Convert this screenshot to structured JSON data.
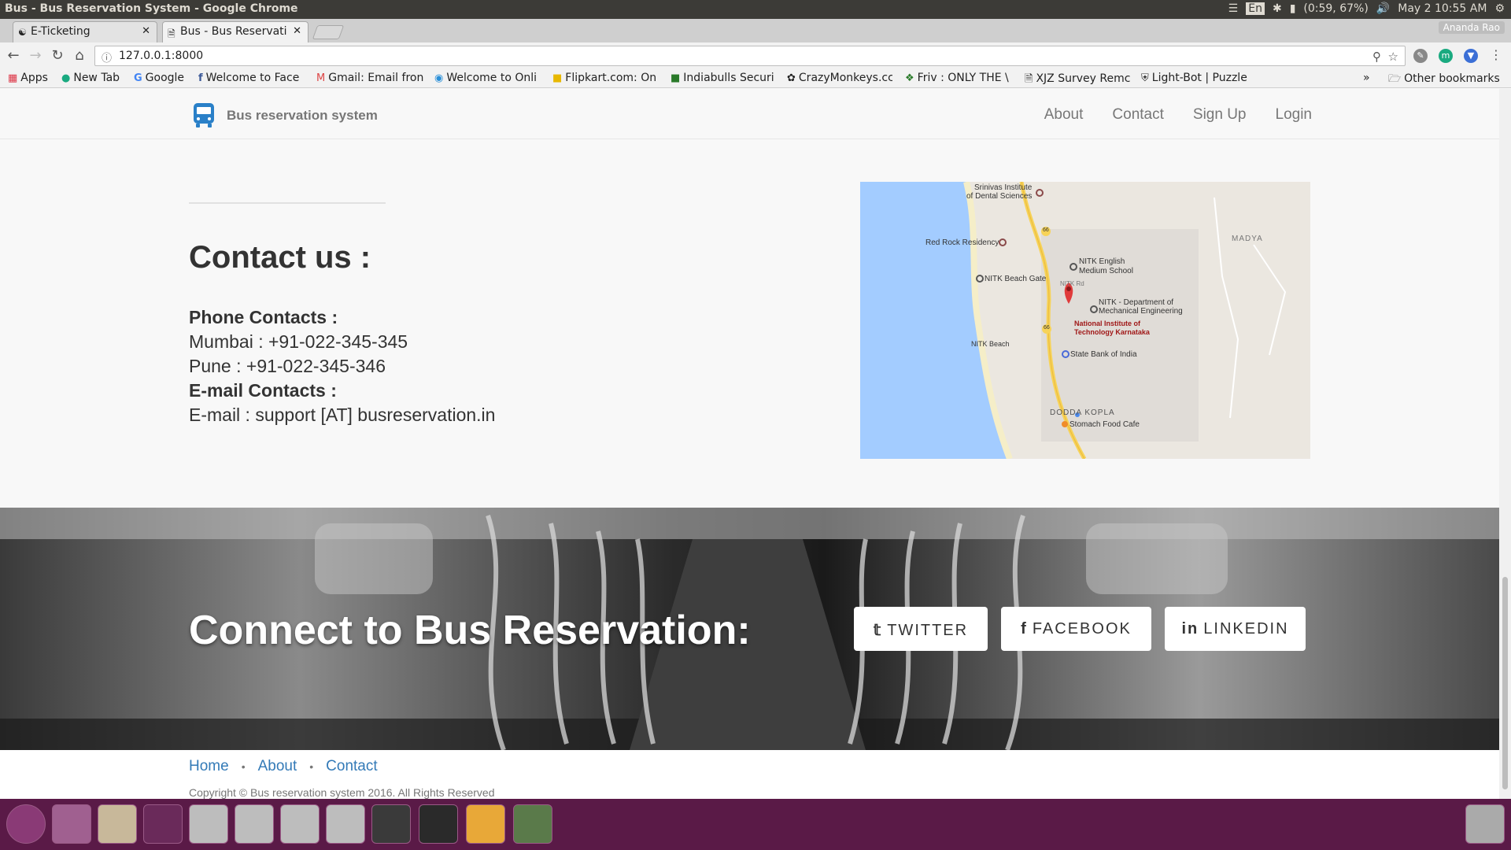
{
  "os": {
    "window_title": "Bus - Bus Reservation System - Google Chrome",
    "lang": "En",
    "battery": "(0:59, 67%)",
    "clock": "May 2 10:55 AM"
  },
  "tabs": [
    {
      "label": "E-Ticketing"
    },
    {
      "label": "Bus - Bus Reservati"
    }
  ],
  "user_badge": "Ananda Rao",
  "address": "127.0.0.1:8000",
  "bookmarks": [
    {
      "label": "Apps",
      "icon": "apps-icon"
    },
    {
      "label": "New Tab",
      "icon": "newtab-icon"
    },
    {
      "label": "Google",
      "icon": "google-icon"
    },
    {
      "label": "Welcome to Face",
      "icon": "facebook-icon"
    },
    {
      "label": "Gmail: Email fron",
      "icon": "gmail-icon"
    },
    {
      "label": "Welcome to Onli",
      "icon": "globe-icon"
    },
    {
      "label": "Flipkart.com: On",
      "icon": "flipkart-icon"
    },
    {
      "label": "Indiabulls Securi",
      "icon": "indiabulls-icon"
    },
    {
      "label": "CrazyMonkeys.cc",
      "icon": "monkey-icon"
    },
    {
      "label": "Friv : ONLY THE \\",
      "icon": "friv-icon"
    },
    {
      "label": "XJZ Survey Remc",
      "icon": "page-icon"
    },
    {
      "label": "Light-Bot | Puzzle",
      "icon": "shield-icon"
    },
    {
      "label": "Other bookmarks",
      "icon": "folder-icon"
    }
  ],
  "site": {
    "brand": "Bus reservation system",
    "nav": [
      "About",
      "Contact",
      "Sign Up",
      "Login"
    ]
  },
  "contact": {
    "title": "Contact us :",
    "phone_heading": "Phone Contacts :",
    "mumbai": "Mumbai : +91-022-345-345",
    "pune": "Pune : +91-022-345-346",
    "email_heading": "E-mail Contacts :",
    "email": "E-mail : support [AT] busreservation.in"
  },
  "map": {
    "labels": [
      "Srinivas Institute",
      "of Dental Sciences",
      "Red Rock Residency",
      "MADYA",
      "NITK English",
      "Medium School",
      "NITK Beach Gate",
      "NITK Rd",
      "NITK - Department of",
      "Mechanical Engineering",
      "National Institute of",
      "Technology Karnataka",
      "NITK Beach",
      "State Bank of India",
      "DODDA KOPLA",
      "Stomach Food Cafe",
      "66",
      "66"
    ]
  },
  "banner": {
    "heading": "Connect to Bus Reservation:",
    "buttons": [
      "TWITTER",
      "FACEBOOK",
      "LINKEDIN"
    ]
  },
  "footer": {
    "links": [
      "Home",
      "About",
      "Contact"
    ],
    "copyright": "Copyright © Bus reservation system 2016. All Rights Reserved"
  },
  "colors": {
    "link": "#337ab7",
    "launcher": "#5a1a47",
    "map_water": "#a3ccff"
  }
}
